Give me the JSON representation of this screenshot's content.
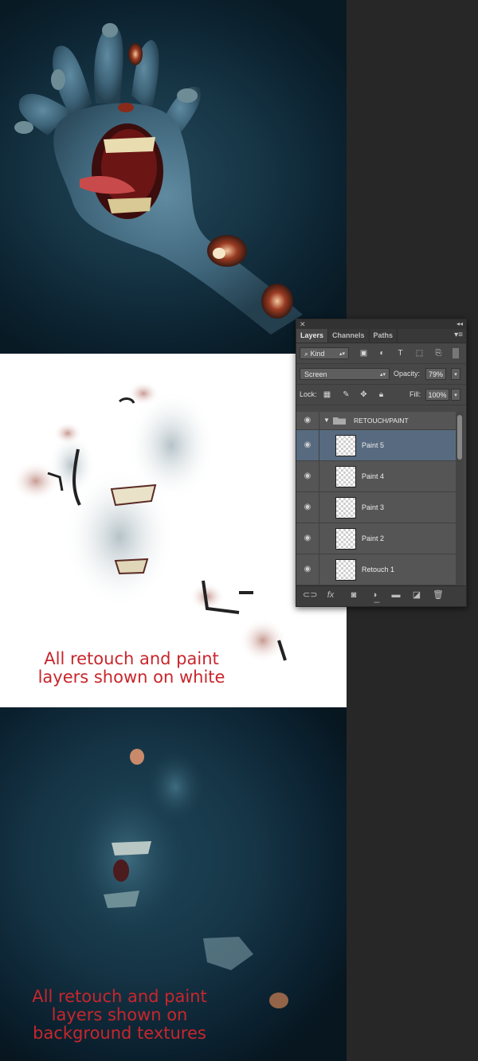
{
  "captions": {
    "white": "All retouch and paint\nlayers shown on white",
    "texture": "All retouch and paint\nlayers shown on\nbackground textures"
  },
  "layers_panel": {
    "tabs": [
      "Layers",
      "Channels",
      "Paths"
    ],
    "active_tab": "Layers",
    "filter_kind": "Kind",
    "blend_mode": "Screen",
    "opacity_label": "Opacity:",
    "opacity_value": "79%",
    "lock_label": "Lock:",
    "fill_label": "Fill:",
    "fill_value": "100%",
    "group_name": "RETOUCH/PAINT",
    "layers": [
      {
        "name": "Paint 5",
        "selected": true
      },
      {
        "name": "Paint 4",
        "selected": false
      },
      {
        "name": "Paint 3",
        "selected": false
      },
      {
        "name": "Paint 2",
        "selected": false
      },
      {
        "name": "Retouch 1",
        "selected": false
      }
    ],
    "bottom_icons": [
      "link-icon",
      "fx-icon",
      "mask-icon",
      "adjustment-icon",
      "folder-icon",
      "new-layer-icon",
      "trash-icon"
    ]
  },
  "colors": {
    "caption_red": "#c8262c",
    "selection_blue": "#576a80",
    "panel_gray": "#474747"
  }
}
